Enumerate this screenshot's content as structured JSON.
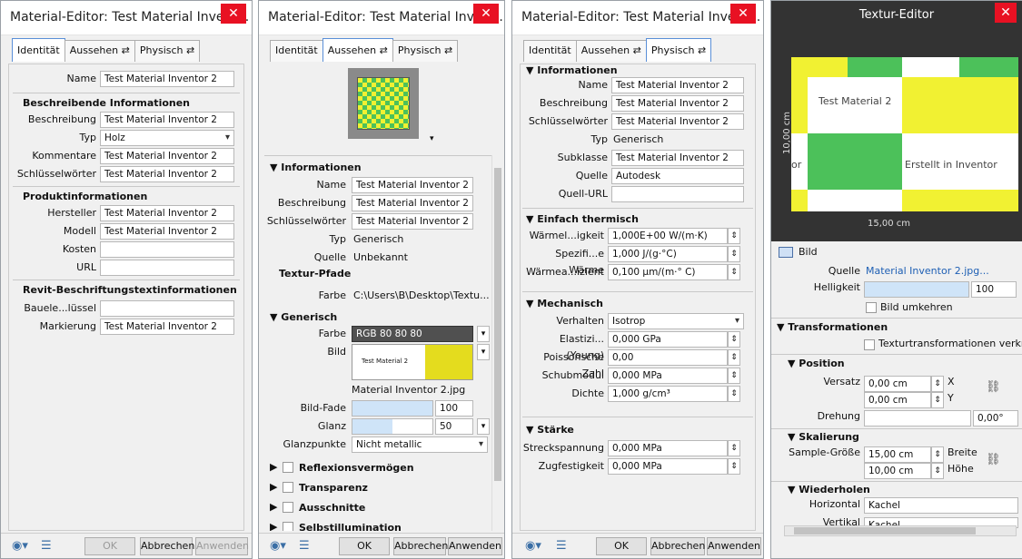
{
  "w1": {
    "title": "Material-Editor: Test Material Invent...",
    "tabs": [
      "Identität",
      "Aussehen ⇄",
      "Physisch ⇄"
    ],
    "name_label": "Name",
    "name_value": "Test Material Inventor 2",
    "sec1": "Beschreibende Informationen",
    "beschreibung_label": "Beschreibung",
    "beschreibung_value": "Test Material Inventor 2",
    "typ_label": "Typ",
    "typ_value": "Holz",
    "kommentare_label": "Kommentare",
    "kommentare_value": "Test Material Inventor 2",
    "schluessel_label": "Schlüsselwörter",
    "schluessel_value": "Test Material Inventor 2",
    "sec2": "Produktinformationen",
    "hersteller_label": "Hersteller",
    "hersteller_value": "Test Material Inventor 2",
    "modell_label": "Modell",
    "modell_value": "Test Material Inventor 2",
    "kosten_label": "Kosten",
    "url_label": "URL",
    "sec3": "Revit-Beschriftungstextinformationen",
    "bauteil_label": "Bauele...lüssel",
    "markierung_label": "Markierung",
    "markierung_value": "Test Material Inventor 2",
    "ok": "OK",
    "cancel": "Abbrechen",
    "apply": "Anwenden"
  },
  "w2": {
    "title": "Material-Editor: Test Material Invent...",
    "tabs": [
      "Identität",
      "Aussehen ⇄",
      "Physisch ⇄"
    ],
    "sec_info": "▼ Informationen",
    "name_label": "Name",
    "name_value": "Test Material Inventor 2",
    "beschreibung_label": "Beschreibung",
    "beschreibung_value": "Test Material Inventor 2",
    "schluessel_label": "Schlüsselwörter",
    "schluessel_value": "Test Material Inventor 2",
    "typ_label": "Typ",
    "typ_value": "Generisch",
    "quelle_label": "Quelle",
    "quelle_value": "Unbekannt",
    "textur_pfade": "Textur-Pfade",
    "farbe_label": "Farbe",
    "farbe_path": "C:\\Users\\B\\Desktop\\Textu...",
    "sec_generisch": "▼ Generisch",
    "gfarbe_label": "Farbe",
    "gfarbe_value": "RGB 80 80 80",
    "bild_label": "Bild",
    "bild_text": "Test Material 2",
    "bild_name": "Material Inventor 2.jpg",
    "bildfade_label": "Bild-Fade",
    "bildfade_value": "100",
    "bildfade_fraction": 1.0,
    "glanz_label": "Glanz",
    "glanz_value": "50",
    "glanz_fraction": 0.5,
    "glanzpunkte_label": "Glanzpunkte",
    "glanzpunkte_value": "Nicht metallic",
    "collapsed": [
      "Reflexionsvermögen",
      "Transparenz",
      "Ausschnitte",
      "Selbstillumination"
    ],
    "ok": "OK",
    "cancel": "Abbrechen",
    "apply": "Anwenden"
  },
  "w3": {
    "title": "Material-Editor: Test Material Invent...",
    "tabs": [
      "Identität",
      "Aussehen ⇄",
      "Physisch ⇄"
    ],
    "sec_info": "▼ Informationen",
    "name_label": "Name",
    "name_value": "Test Material Inventor 2",
    "beschreibung_label": "Beschreibung",
    "beschreibung_value": "Test Material Inventor 2",
    "schluessel_label": "Schlüsselwörter",
    "schluessel_value": "Test Material Inventor 2",
    "typ_label": "Typ",
    "typ_value": "Generisch",
    "subklasse_label": "Subklasse",
    "subklasse_value": "Test Material Inventor 2",
    "quelle_label": "Quelle",
    "quelle_value": "Autodesk",
    "quellurl_label": "Quell-URL",
    "sec_therm": "▼ Einfach thermisch",
    "waerme1_label": "Wärmel...igkeit",
    "waerme1_value": "1,000E+00 W/(m·K)",
    "spez_label": "Spezifi...e Wärme",
    "spez_value": "1,000 J/(g·°C)",
    "waerme2_label": "Wärmea...izient",
    "waerme2_value": "0,100 µm/(m·° C)",
    "sec_mech": "▼ Mechanisch",
    "verhalten_label": "Verhalten",
    "verhalten_value": "Isotrop",
    "elast_label": "Elastizi... (Young)",
    "elast_value": "0,000 GPa",
    "poisson_label": "Poissonsche Zahl",
    "poisson_value": "0,00",
    "schub_label": "Schubmodul",
    "schub_value": "0,000 MPa",
    "dichte_label": "Dichte",
    "dichte_value": "1,000 g/cm³",
    "sec_staerke": "▼ Stärke",
    "streck_label": "Streckspannung",
    "streck_value": "0,000 MPa",
    "zug_label": "Zugfestigkeit",
    "zug_value": "0,000 MPa",
    "ok": "OK",
    "cancel": "Abbrechen",
    "apply": "Anwenden"
  },
  "w4": {
    "title": "Textur-Editor",
    "prev_text1": "Test Material 2",
    "prev_text2": "Erstellt in Inventor",
    "prev_text3": "or",
    "dim_h": "15,00 cm",
    "dim_v": "10,00 cm",
    "bild": "Bild",
    "quelle_label": "Quelle",
    "quelle_value": "Material Inventor 2.jpg...",
    "hell_label": "Helligkeit",
    "hell_value": "100",
    "hell_fraction": 1.0,
    "umkehren": "Bild umkehren",
    "sec_trans": "▼ Transformationen",
    "verknuepfen": "Texturtransformationen verknüpfen",
    "sec_pos": "▼ Position",
    "versatz_label": "Versatz",
    "versatz_x": "0,00 cm",
    "versatz_y": "0,00 cm",
    "x": "X",
    "y": "Y",
    "drehung_label": "Drehung",
    "drehung_value": "0,00°",
    "sec_skal": "▼ Skalierung",
    "sample_label": "Sample-Größe",
    "breite_value": "15,00 cm",
    "hoehe_value": "10,00 cm",
    "breite": "Breite",
    "hoehe": "Höhe",
    "sec_wied": "▼ Wiederholen",
    "horiz_label": "Horizontal",
    "horiz_value": "Kachel",
    "vert_label": "Vertikal",
    "vert_value": "Kachel"
  },
  "colors": {
    "green": "#4cc15a",
    "yellow": "#f1f132",
    "close": "#e81123",
    "dark": "#333333"
  }
}
